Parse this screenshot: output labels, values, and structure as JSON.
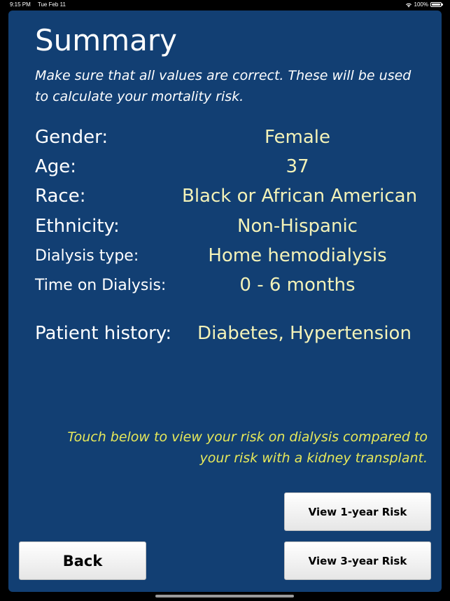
{
  "status_bar": {
    "time": "9:15 PM",
    "date": "Tue Feb 11",
    "battery": "100%",
    "battery_level": 1.0,
    "wifi_icon": "wifi-icon",
    "battery_icon": "battery-icon"
  },
  "summary": {
    "title": "Summary",
    "instructions": "Make sure that all values are correct. These will be used to calculate your mortality risk.",
    "fields": {
      "gender": {
        "label": "Gender:",
        "value": "Female"
      },
      "age": {
        "label": "Age:",
        "value": "37"
      },
      "race": {
        "label": "Race:",
        "value": "Black or African American"
      },
      "ethnicity": {
        "label": "Ethnicity:",
        "value": "Non-Hispanic"
      },
      "dialysis_type": {
        "label": "Dialysis type:",
        "value": "Home hemodialysis"
      },
      "time_on_dialysis": {
        "label": "Time on Dialysis:",
        "value": "0 - 6 months"
      },
      "patient_history": {
        "label": "Patient history:",
        "value": "Diabetes, Hypertension"
      }
    },
    "hint": "Touch below to view your risk on dialysis compared to your risk with a kidney transplant."
  },
  "buttons": {
    "view_1_year": "View 1-year Risk",
    "view_3_year": "View 3-year Risk",
    "back": "Back"
  },
  "colors": {
    "panel_background": "#123f73",
    "value_text": "#f3f2b8",
    "hint_text": "#e6e85a"
  }
}
